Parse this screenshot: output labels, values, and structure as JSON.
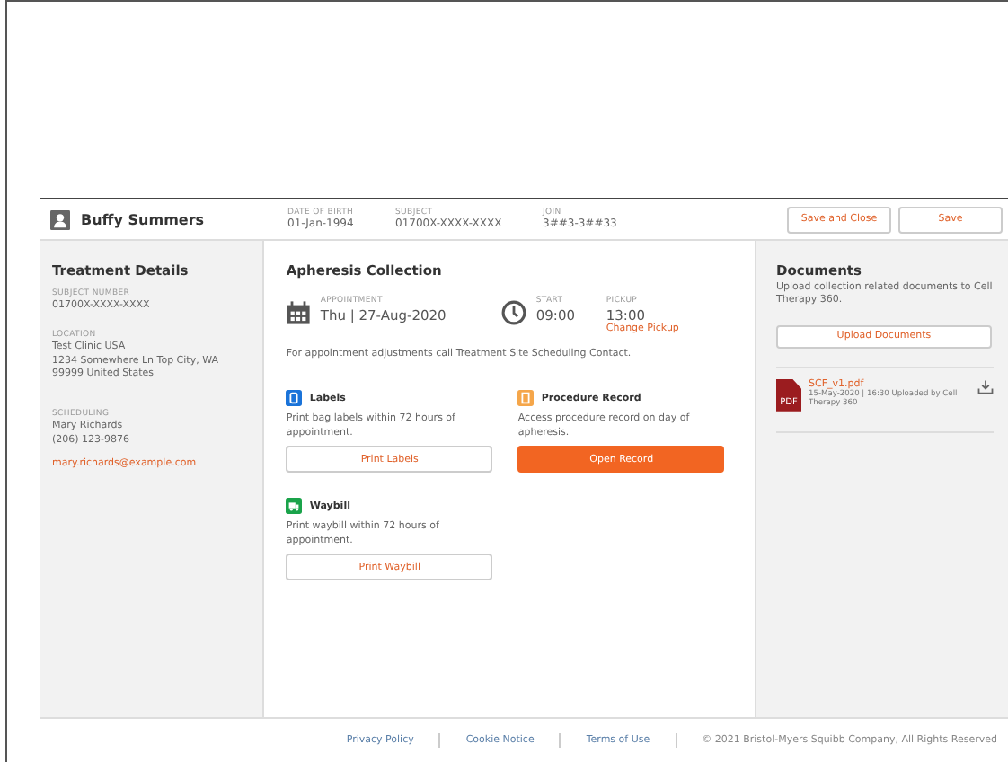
{
  "header": {
    "name": "Buffy Summers",
    "fields": [
      {
        "label": "DATE OF BIRTH",
        "value": "01-Jan-1994"
      },
      {
        "label": "SUBJECT",
        "value": "01700X-XXXX-XXXX"
      },
      {
        "label": "JOIN",
        "value": "3##3-3##33"
      }
    ],
    "buttons": [
      "Save and Close",
      "Save"
    ]
  },
  "treatment": {
    "title": "Treatment Details",
    "sections": [
      {
        "label": "SUBJECT NUMBER",
        "lines": [
          "01700X-XXXX-XXXX"
        ]
      },
      {
        "label": "LOCATION",
        "lines": [
          "Test Clinic USA",
          "1234 Somewhere Ln Top City, WA",
          "99999 United States"
        ]
      },
      {
        "label": "SCHEDULING",
        "lines": [
          "Mary Richards",
          "(206) 123-9876"
        ],
        "email": "mary.richards@example.com"
      }
    ]
  },
  "collection": {
    "title": "Apheresis Collection",
    "appointment": {
      "label": "APPOINTMENT",
      "value": "Thu | 27-Aug-2020"
    },
    "start": {
      "label": "START",
      "value": "09:00"
    },
    "pickup": {
      "label": "PICKUP",
      "value": "13:00",
      "link": "Change Pickup"
    },
    "note": "For appointment adjustments call Treatment Site Scheduling Contact.",
    "tasks": [
      {
        "kind": "labels",
        "color": "#1a73d9",
        "title": "Labels",
        "text": "Print bag labels within 72 hours of appointment.",
        "button": "Print Labels",
        "primary": false
      },
      {
        "kind": "record",
        "color": "#f5a64a",
        "title": "Procedure Record",
        "text": "Access procedure record on  day of apheresis.",
        "button": "Open Record",
        "primary": true
      },
      {
        "kind": "waybill",
        "color": "#1aa34a",
        "title": "Waybill",
        "text": "Print waybill within 72 hours of appointment.",
        "button": "Print Waybill",
        "primary": false
      }
    ]
  },
  "documents": {
    "title": "Documents",
    "text": "Upload collection related documents to Cell Therapy 360.",
    "button": "Upload Documents",
    "files": [
      {
        "name": "SCF_v1.pdf",
        "badge": "PDF",
        "meta": "15-May-2020 | 16:30 Uploaded by Cell Therapy 360"
      }
    ]
  },
  "footer": {
    "links": [
      "Privacy Policy",
      "Cookie Notice",
      "Terms of Use"
    ],
    "copyright": "© 2021 Bristol-Myers Squibb Company, All Rights Reserved"
  }
}
